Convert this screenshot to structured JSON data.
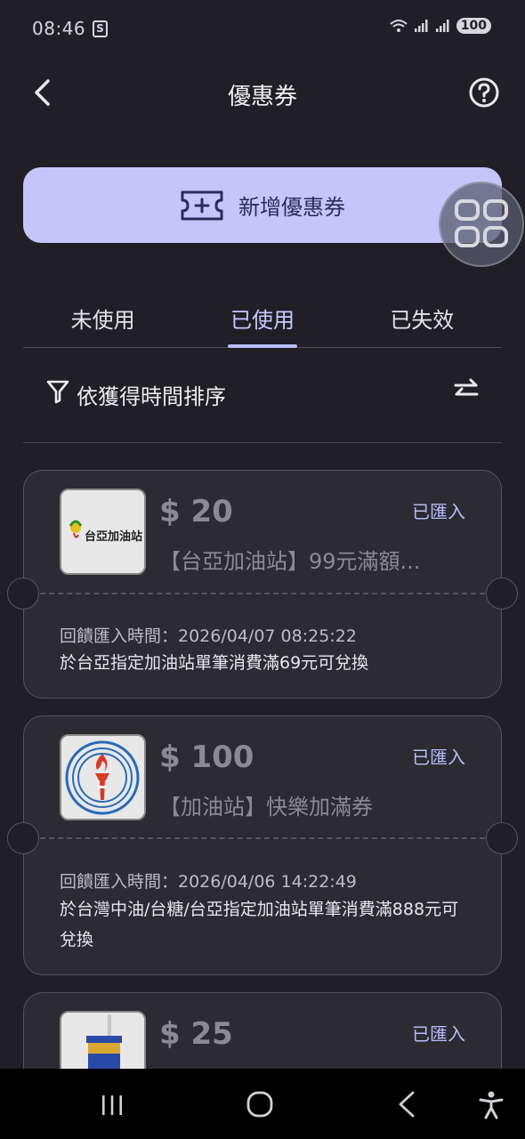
{
  "status_bar": {
    "time": "08:46",
    "notification_icon": "shopping-bag-icon",
    "battery": "100"
  },
  "header": {
    "title": "優惠券",
    "back_icon": "back-arrow-icon",
    "help_icon": "help-circle-icon"
  },
  "add_coupon": {
    "label": "新增優惠券",
    "icon": "ticket-plus-icon"
  },
  "floating_menu_icon": "grid-menu-icon",
  "tabs": [
    {
      "label": "未使用",
      "active": false
    },
    {
      "label": "已使用",
      "active": true
    },
    {
      "label": "已失效",
      "active": false
    }
  ],
  "sort": {
    "label": "依獲得時間排序",
    "filter_icon": "filter-icon",
    "swap_icon": "swap-arrows-icon"
  },
  "coupons": [
    {
      "logo_text": "台亞加油站",
      "amount": "$ 20",
      "status": "已匯入",
      "title": "【台亞加油站】99元滿額...",
      "redeem_time": "回饋匯入時間：2026/04/07 08:25:22",
      "condition": "於台亞指定加油站單筆消費滿69元可兌換"
    },
    {
      "logo_text": "",
      "amount": "$ 100",
      "status": "已匯入",
      "title": "【加油站】快樂加滿券",
      "redeem_time": "回饋匯入時間：2026/04/06 14:22:49",
      "condition": "於台灣中油/台糖/台亞指定加油站單筆消費滿888元可兌換"
    },
    {
      "logo_text": "",
      "amount": "$ 25",
      "status": "已匯入",
      "title": "",
      "redeem_time": "",
      "condition": ""
    }
  ],
  "colors": {
    "accent": "#c4c6fb",
    "background": "#1f1f25",
    "card": "#2b2b31"
  }
}
